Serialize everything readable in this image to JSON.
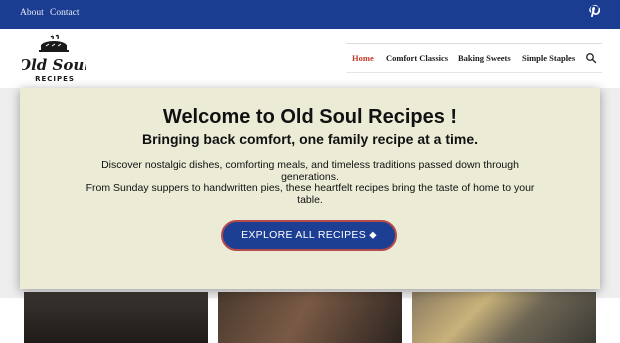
{
  "topbar": {
    "links": [
      "About",
      "Contact"
    ],
    "social_icon": "pinterest-icon",
    "bg_color": "#1a3d91"
  },
  "logo": {
    "line1": "Old Soul",
    "line2": "RECIPES",
    "icon": "pie-icon"
  },
  "nav": {
    "items": [
      "Home",
      "Comfort Classics",
      "Baking Sweets",
      "Simple Staples"
    ],
    "active_color": "#c0392b",
    "search_icon": "search-icon"
  },
  "hero": {
    "title": "Welcome to Old Soul Recipes !",
    "subtitle": "Bringing back comfort, one family recipe at a time.",
    "para1": "Discover nostalgic dishes, comforting meals, and timeless traditions passed down through generations.",
    "para2": "From Sunday suppers to handwritten pies, these heartfelt recipes bring the taste of home to your table.",
    "cta_label": "EXPLORE ALL RECIPES ⬥",
    "cta_color": "#1d3f93",
    "bg_color": "#ecebd6"
  }
}
